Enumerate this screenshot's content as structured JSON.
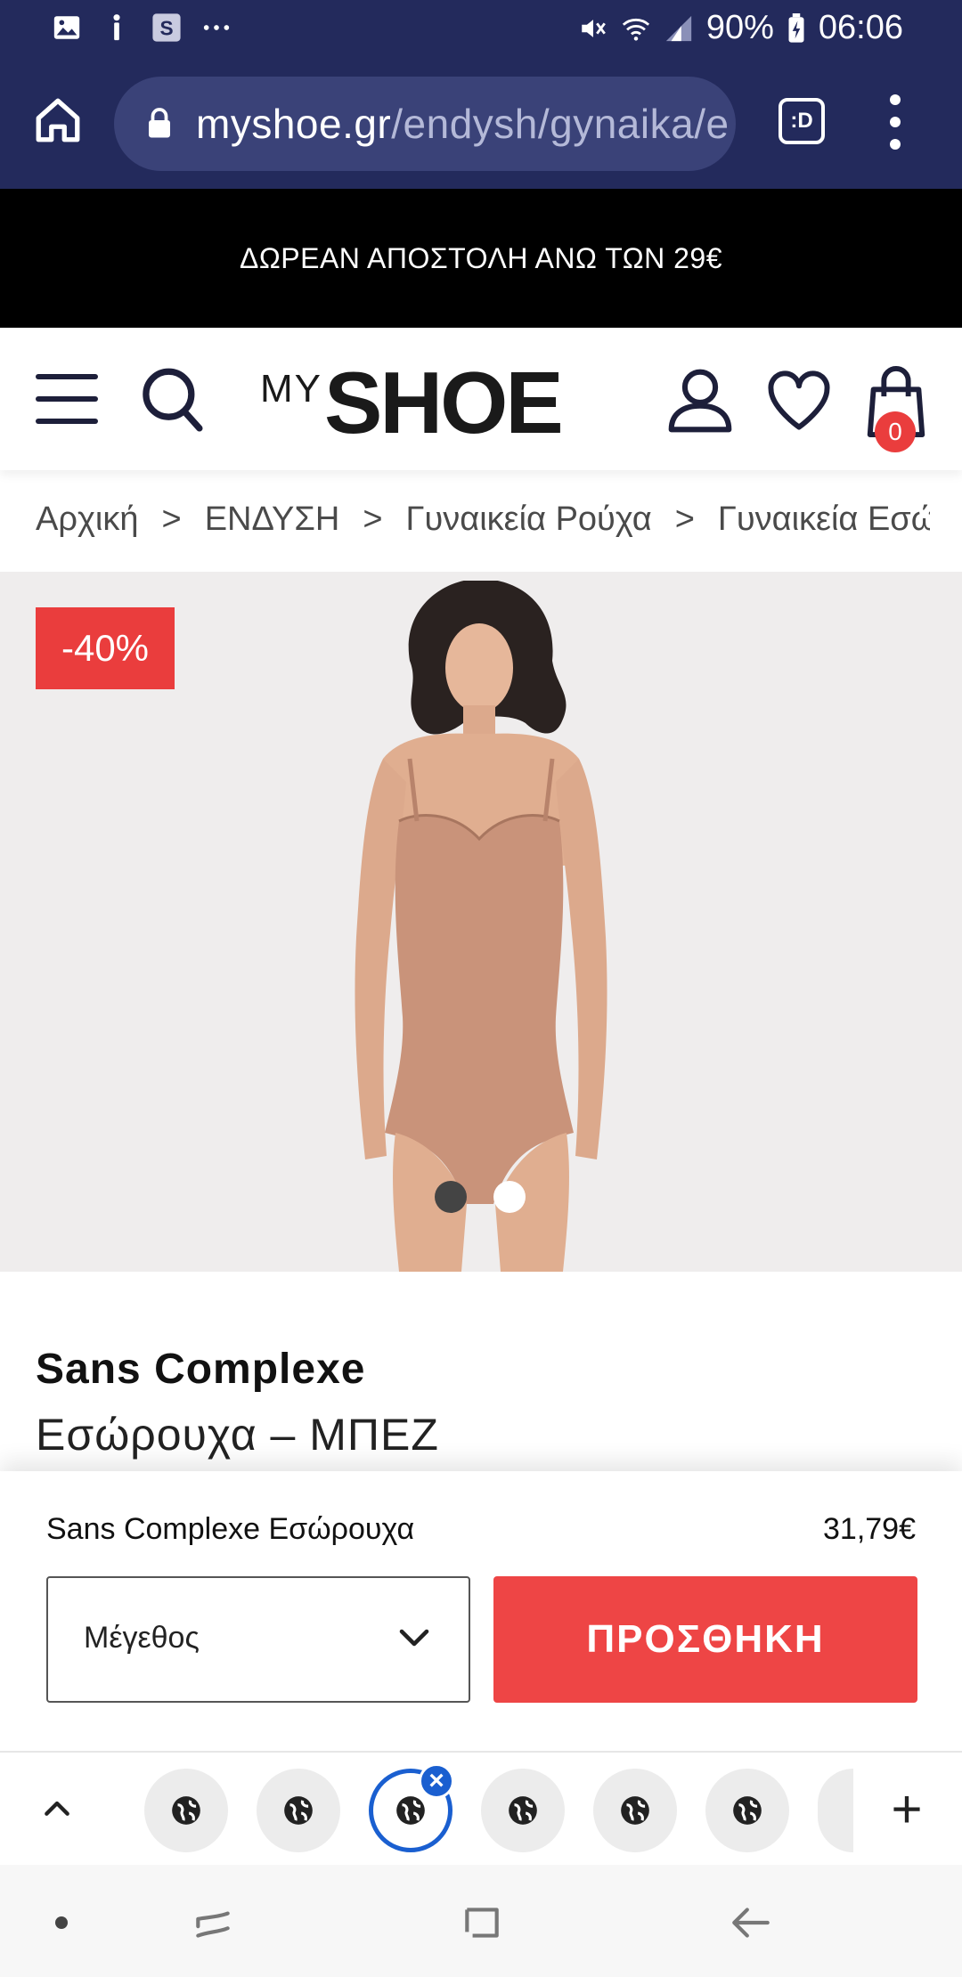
{
  "status_bar": {
    "battery": "90%",
    "time": "06:06",
    "notif_icons": [
      "gallery-icon",
      "accessibility-icon",
      "s-app-icon",
      "more-icon"
    ]
  },
  "browser": {
    "url_domain": "myshoe.gr",
    "url_path": "/endysh/gynaika/e",
    "tab_icon_label": ":D"
  },
  "promo": {
    "text": "ΔΩΡΕΑΝ ΑΠΟΣΤΟΛΗ ΑΝΩ ΤΩΝ 29€"
  },
  "header": {
    "logo_my": "MY",
    "logo_shoe": "SHOE",
    "cart_count": "0"
  },
  "breadcrumb": {
    "items": [
      "Αρχική",
      "ΕΝΔΥΣΗ",
      "Γυναικεία Ρούχα",
      "Γυναικεία Εσώρουχα"
    ],
    "separator": ">"
  },
  "product": {
    "discount": "-40%",
    "brand": "Sans Complexe",
    "name": "Εσώρουχα – ΜΠΕΖ",
    "image_count": 2,
    "active_image": 1
  },
  "sticky_cart": {
    "title": "Sans Complexe Εσώρουχα",
    "price": "31,79€",
    "size_placeholder": "Μέγεθος",
    "add_button": "ΠΡΟΣΘΗΚΗ"
  },
  "tabs": {
    "count": 6,
    "active_index": 2,
    "plus": "+"
  },
  "colors": {
    "browser_bar": "#232a5c",
    "accent_red": "#ea3d3d",
    "active_tab": "#1a5fd0"
  }
}
